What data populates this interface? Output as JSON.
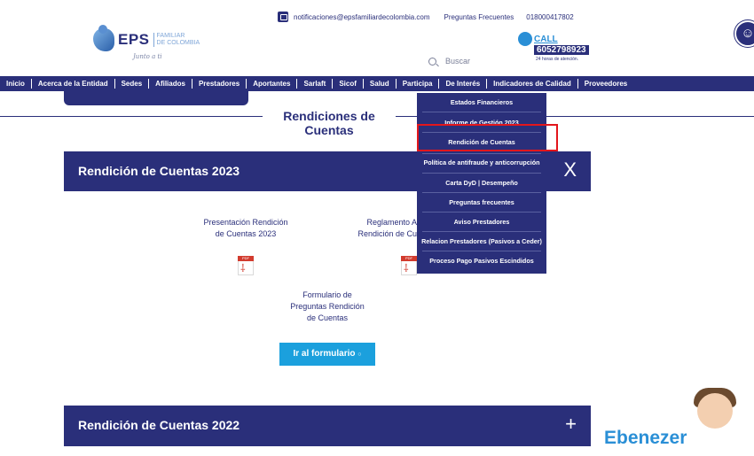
{
  "header": {
    "email": "notificaciones@epsfamiliardecolombia.com",
    "faq": "Preguntas Frecuentes",
    "phone": "018000417802",
    "logo_main": "EPS",
    "logo_sub1": "FAMILIAR",
    "logo_sub2": "DE COLOMBIA",
    "logo_script": "Junto a ti",
    "search_placeholder": "Buscar",
    "callcenter_title": "CALL CENTER",
    "callcenter_number": "6052798923",
    "callcenter_hours": "24 horas de atención."
  },
  "nav": {
    "items": [
      "Inicio",
      "Acerca de la Entidad",
      "Sedes",
      "Afiliados",
      "Prestadores",
      "Aportantes",
      "Sarlaft",
      "Sicof",
      "Salud",
      "Participa",
      "De Interés",
      "Indicadores de Calidad",
      "Proveedores"
    ]
  },
  "page": {
    "title": "Rendiciones de Cuentas"
  },
  "accordion_2023": {
    "title": "Rendición de Cuentas 2023",
    "toggle": "X",
    "doc1_line1": "Presentación Rendición",
    "doc1_line2": "de Cuentas 2023",
    "doc2_line1": "Reglamento A",
    "doc2_line2": "Rendición de Cu",
    "pdf_label": "PDF",
    "form_line1": "Formulario de",
    "form_line2": "Preguntas Rendición",
    "form_line3": "de Cuentas",
    "form_button": "Ir al formulario"
  },
  "accordion_2022": {
    "title": "Rendición de Cuentas 2022",
    "toggle": "+"
  },
  "dropdown": {
    "items": [
      "Estados Financieros",
      "Informe de Gestión 2023",
      "Rendición de Cuentas",
      "Política de antifraude y anticorrupción",
      "Carta DyD | Desempeño",
      "Preguntas frecuentes",
      "Aviso Prestadores",
      "Relacion Prestadores (Pasivos a Ceder)",
      "Proceso Pago Pasivos Escindidos"
    ]
  },
  "brand": {
    "text": "Ebenezer"
  },
  "colors": {
    "navy": "#2a2f7a",
    "accent_blue": "#1ba0dd",
    "highlight_red": "#e3161c",
    "pdf_red": "#d23b2e"
  },
  "icons": [
    "mail-icon",
    "search-icon",
    "accessibility-icon",
    "pdf-icon",
    "close-icon",
    "plus-icon"
  ]
}
